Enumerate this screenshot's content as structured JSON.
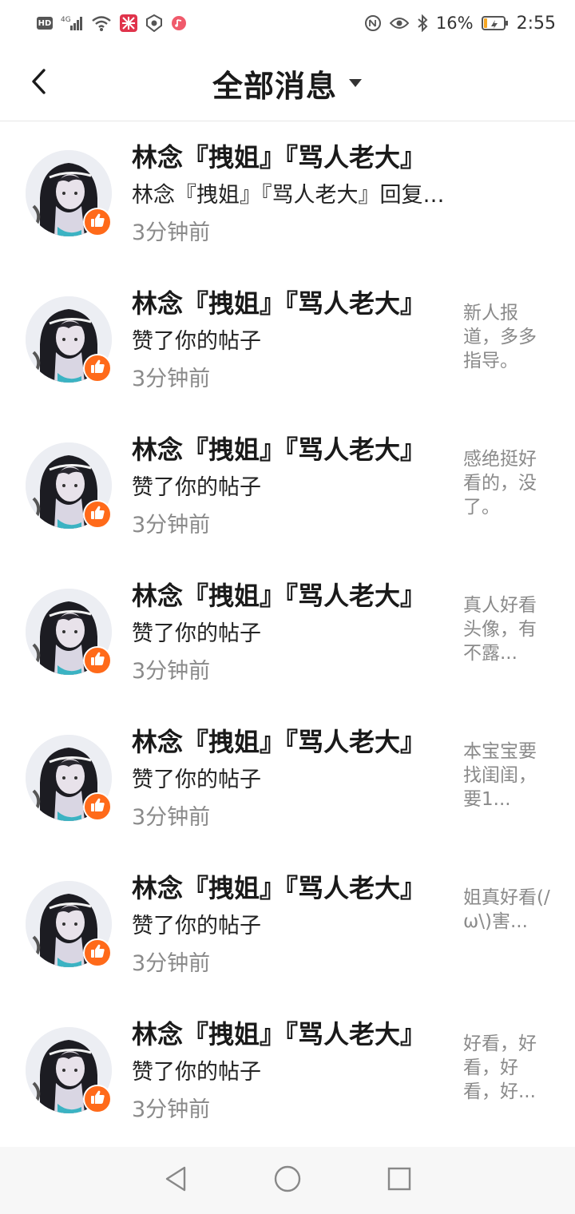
{
  "status_bar": {
    "hd_label": "HD",
    "network_label": "4G",
    "battery_percent": "16%",
    "time": "2:55",
    "icons": [
      "hd-icon",
      "signal-icon",
      "wifi-icon",
      "app-notification-icon",
      "shield-notification-icon",
      "music-notification-icon",
      "nfc-icon",
      "eye-icon",
      "bluetooth-icon",
      "battery-icon"
    ],
    "battery_level": 0.16,
    "battery_color": "#f5a623"
  },
  "header": {
    "title": "全部消息",
    "back_icon": "chevron-left-icon",
    "dropdown_icon": "caret-down-icon"
  },
  "accent_color": "#ff6a1a",
  "messages": [
    {
      "name": "林念『拽姐』『骂人老大』",
      "action": "林念『拽姐』『骂人老大』回复了你",
      "time": "3分钟前",
      "preview": ""
    },
    {
      "name": "林念『拽姐』『骂人老大』",
      "action": "赞了你的帖子",
      "time": "3分钟前",
      "preview": "新人报道，多多指导。"
    },
    {
      "name": "林念『拽姐』『骂人老大』",
      "action": "赞了你的帖子",
      "time": "3分钟前",
      "preview": "感绝挺好看的，没了。"
    },
    {
      "name": "林念『拽姐』『骂人老大』",
      "action": "赞了你的帖子",
      "time": "3分钟前",
      "preview": "真人好看头像，有不露..."
    },
    {
      "name": "林念『拽姐』『骂人老大』",
      "action": "赞了你的帖子",
      "time": "3分钟前",
      "preview": "本宝宝要找闺闺，要1..."
    },
    {
      "name": "林念『拽姐』『骂人老大』",
      "action": "赞了你的帖子",
      "time": "3分钟前",
      "preview": "姐真好看(/ω\\)害..."
    },
    {
      "name": "林念『拽姐』『骂人老大』",
      "action": "赞了你的帖子",
      "time": "3分钟前",
      "preview": "好看，好看，好看，好..."
    }
  ],
  "nav_bar": {
    "buttons": [
      "back-triangle-icon",
      "home-circle-icon",
      "recents-square-icon"
    ]
  }
}
